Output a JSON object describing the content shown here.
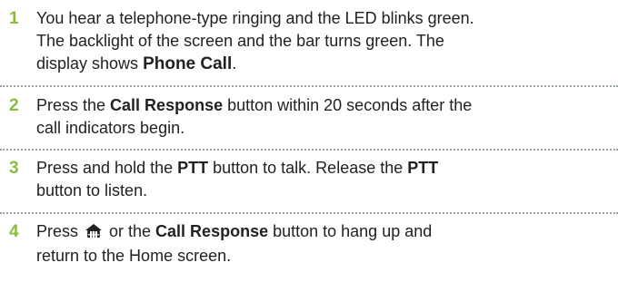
{
  "accent_color": "#8bbb3f",
  "steps": [
    {
      "number": "1",
      "line1": "You hear a telephone-type ringing and the LED blinks green.",
      "line2": "The backlight of the screen and the bar turns green. The",
      "line3_prefix": "display shows ",
      "line3_display": "Phone Call",
      "line3_suffix": "."
    },
    {
      "number": "2",
      "prefix": "Press the ",
      "bold": "Call Response",
      "suffix": " button within 20 seconds after the",
      "line2": "call indicators begin."
    },
    {
      "number": "3",
      "prefix": "Press and hold the ",
      "bold1": "PTT",
      "middle": " button to talk. Release the ",
      "bold2": "PTT",
      "line2": "button to listen."
    },
    {
      "number": "4",
      "prefix": "Press ",
      "icon": "home-icon",
      "middle": " or the ",
      "bold": "Call Response",
      "suffix": " button to hang up and",
      "line2": "return to the Home screen."
    }
  ]
}
